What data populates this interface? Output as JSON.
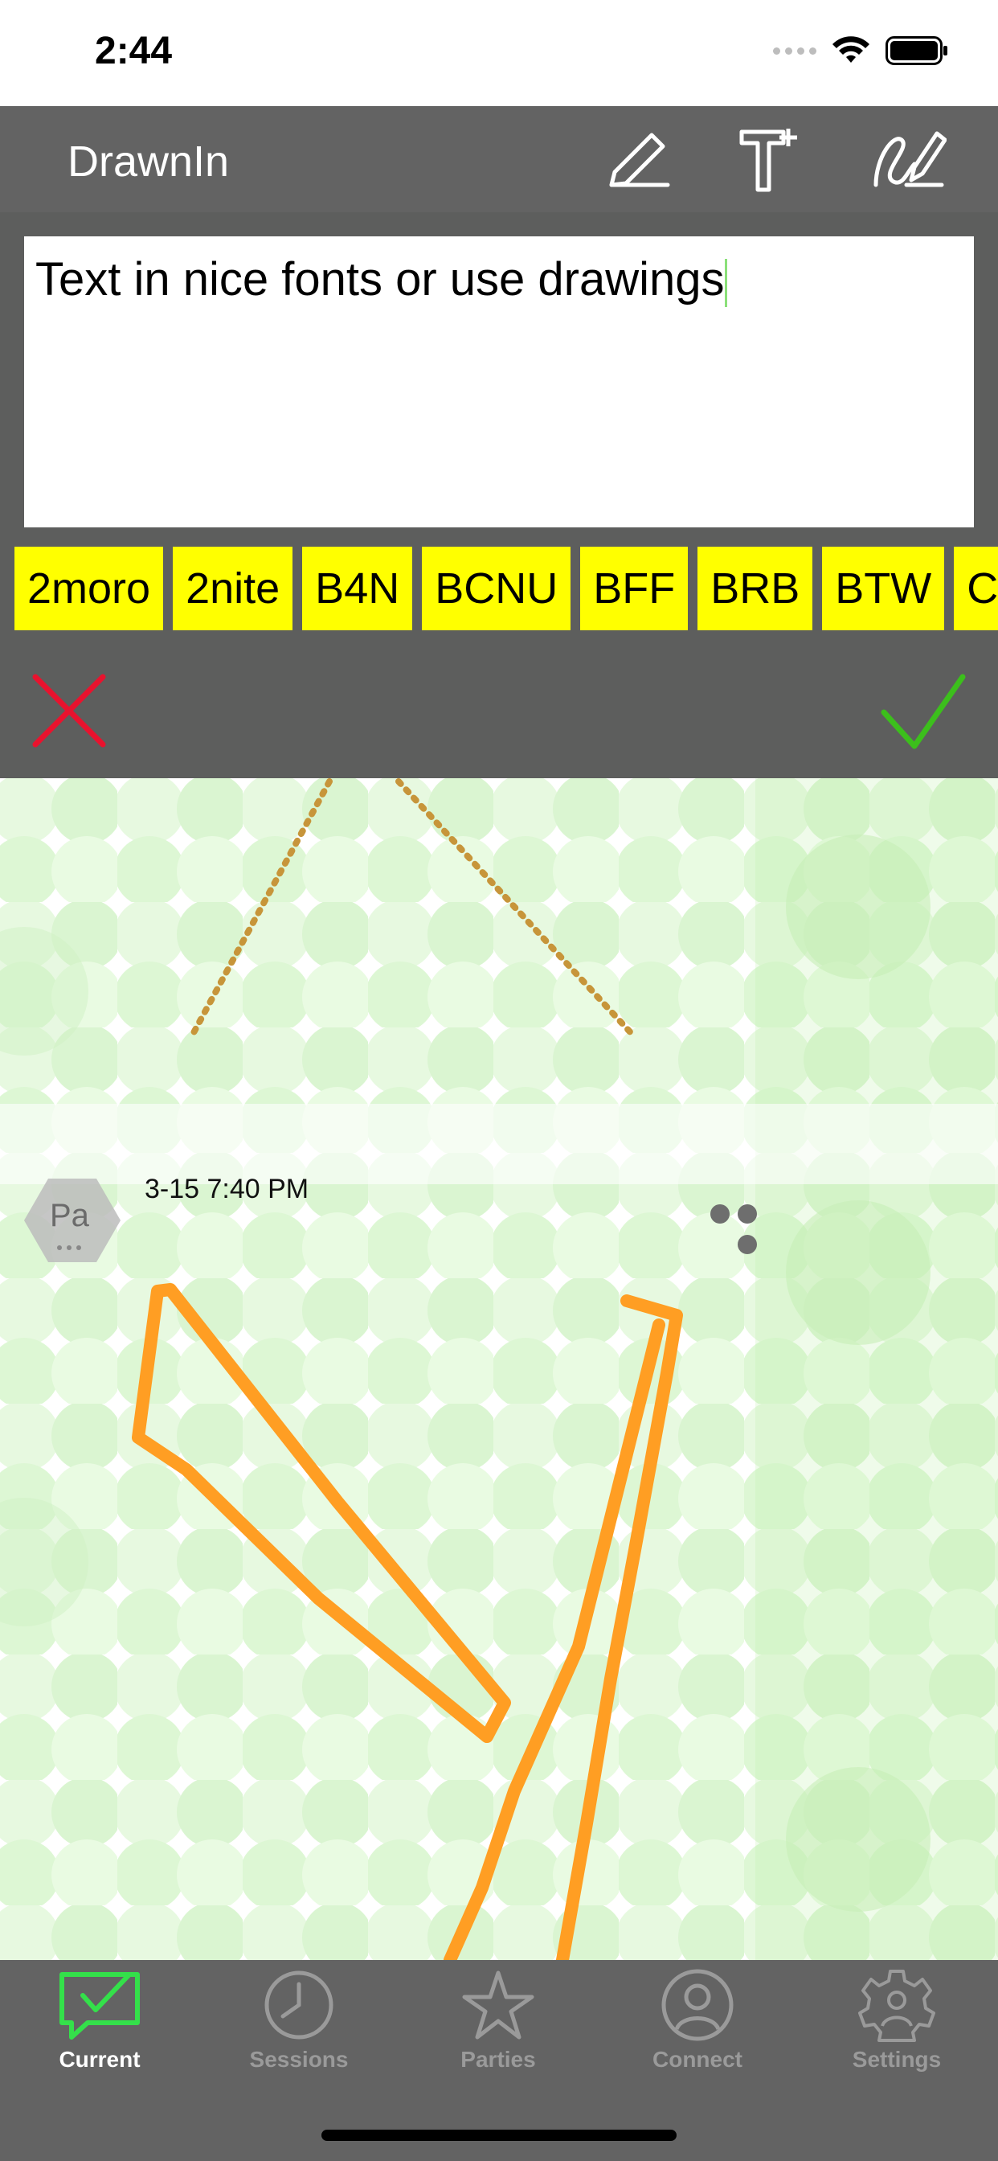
{
  "status_bar": {
    "time": "2:44"
  },
  "nav": {
    "title": "DrawnIn",
    "buttons": [
      "pencil-icon",
      "add-text-icon",
      "signature-icon"
    ]
  },
  "compose": {
    "text_value": "Text in nice fonts or use drawings",
    "abbreviations": [
      "2moro",
      "2nite",
      "B4N",
      "BCNU",
      "BFF",
      "BRB",
      "BTW",
      "C"
    ],
    "cancel_icon": "close-icon",
    "confirm_icon": "checkmark-icon",
    "colors": {
      "cancel": "#e8132e",
      "confirm": "#3cbf1c",
      "chip": "#ffff00"
    }
  },
  "message": {
    "avatar_initials": "Pa",
    "timestamp": "3-15 7:40 PM"
  },
  "tabs": [
    {
      "label": "Current",
      "icon": "chat-check-icon",
      "active": true
    },
    {
      "label": "Sessions",
      "icon": "clock-icon",
      "active": false
    },
    {
      "label": "Parties",
      "icon": "star-icon",
      "active": false
    },
    {
      "label": "Connect",
      "icon": "person-circle-icon",
      "active": false
    },
    {
      "label": "Settings",
      "icon": "gear-person-icon",
      "active": false
    }
  ],
  "colors": {
    "bar_bg": "#636363",
    "accent_active": "#34e04a",
    "drawing_stroke": "#ff9e23"
  }
}
